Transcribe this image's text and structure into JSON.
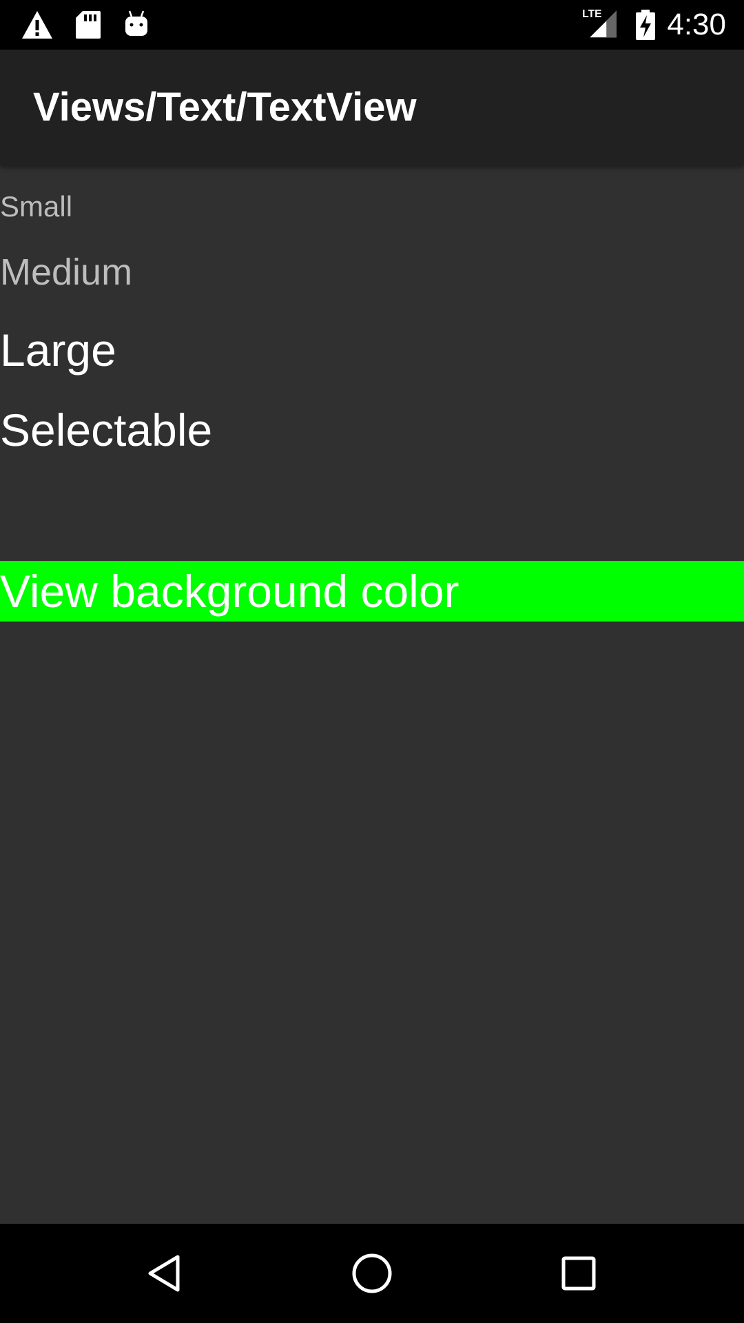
{
  "status_bar": {
    "time": "4:30",
    "network_label": "LTE",
    "icons": [
      "warning-icon",
      "sd-card-icon",
      "android-debug-icon",
      "lte-signal-icon",
      "battery-charging-icon"
    ]
  },
  "app_bar": {
    "title": "Views/Text/TextView"
  },
  "content": {
    "small_text": "Small",
    "medium_text": "Medium",
    "large_text": "Large",
    "selectable_text": "Selectable",
    "background_text": "View background color"
  },
  "colors": {
    "background": "#303030",
    "app_bar": "#212121",
    "status_bar": "#000000",
    "highlight_background": "#00ff00",
    "secondary_text": "#bdbdbd",
    "primary_text": "#ffffff"
  },
  "nav_bar": {
    "icons": [
      "back-icon",
      "home-icon",
      "recents-icon"
    ]
  }
}
